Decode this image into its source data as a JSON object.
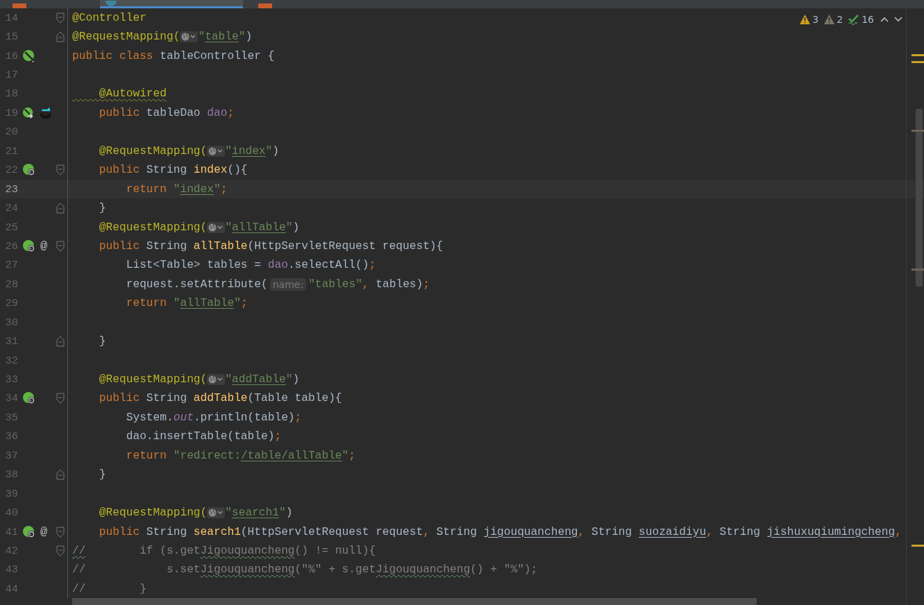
{
  "tabs": [
    {
      "kind": "jsp",
      "selected": false
    },
    {
      "kind": "java",
      "selected": true
    },
    {
      "kind": "jsp",
      "selected": false
    }
  ],
  "inspections": [
    {
      "kind": "warning",
      "count": "3"
    },
    {
      "kind": "weak-warning",
      "count": "2"
    },
    {
      "kind": "typo",
      "count": "16"
    }
  ],
  "lines": [
    {
      "number": "14",
      "fold_start": true,
      "fold_end": false,
      "tokens": [
        {
          "kind": "ann",
          "text": "@Controller"
        }
      ]
    },
    {
      "number": "15",
      "fold_start": false,
      "fold_end": true,
      "tokens": [
        {
          "kind": "ann",
          "text": "@RequestMapping("
        },
        {
          "kind": "url-icon"
        },
        {
          "kind": "str",
          "text": "\""
        },
        {
          "kind": "link",
          "text": "table"
        },
        {
          "kind": "str",
          "text": "\""
        },
        {
          "kind": "plain",
          "text": ")"
        }
      ]
    },
    {
      "number": "16",
      "fold_start": false,
      "fold_end": false,
      "markers": [
        {
          "kind": "bean"
        }
      ],
      "tokens": [
        {
          "kind": "kw",
          "text": "public class "
        },
        {
          "kind": "plain",
          "text": "tableController {"
        }
      ]
    },
    {
      "number": "17",
      "fold_start": false,
      "fold_end": false
    },
    {
      "number": "18",
      "fold_start": false,
      "fold_end": false,
      "tokens": [
        {
          "kind": "ann-warn",
          "text": "    @Autowired"
        }
      ]
    },
    {
      "number": "19",
      "fold_start": false,
      "fold_end": false,
      "markers": [
        {
          "kind": "bean-inject"
        },
        {
          "kind": "creature"
        }
      ],
      "tokens": [
        {
          "kind": "kw",
          "text": "    public "
        },
        {
          "kind": "plain",
          "text": "tableDao "
        },
        {
          "kind": "field",
          "text": "dao"
        },
        {
          "kind": "kw",
          "text": ";"
        }
      ]
    },
    {
      "number": "20",
      "fold_start": false,
      "fold_end": false
    },
    {
      "number": "21",
      "fold_start": false,
      "fold_end": false,
      "tokens": [
        {
          "kind": "ann",
          "text": "    @RequestMapping("
        },
        {
          "kind": "url-icon"
        },
        {
          "kind": "str",
          "text": "\""
        },
        {
          "kind": "link",
          "text": "index"
        },
        {
          "kind": "str",
          "text": "\""
        },
        {
          "kind": "plain",
          "text": ")"
        }
      ]
    },
    {
      "number": "22",
      "fold_start": true,
      "fold_end": false,
      "markers": [
        {
          "kind": "web"
        }
      ],
      "tokens": [
        {
          "kind": "kw",
          "text": "    public "
        },
        {
          "kind": "plain",
          "text": "String "
        },
        {
          "kind": "method",
          "text": "index"
        },
        {
          "kind": "plain",
          "text": "(){"
        }
      ]
    },
    {
      "number": "23",
      "fold_start": false,
      "fold_end": false,
      "current": true,
      "tokens": [
        {
          "kind": "kw",
          "text": "        return "
        },
        {
          "kind": "str",
          "text": "\""
        },
        {
          "kind": "link",
          "text": "index"
        },
        {
          "kind": "str",
          "text": "\""
        },
        {
          "kind": "kw",
          "text": ";"
        }
      ]
    },
    {
      "number": "24",
      "fold_start": false,
      "fold_end": true,
      "tokens": [
        {
          "kind": "plain",
          "text": "    }"
        }
      ]
    },
    {
      "number": "25",
      "fold_start": false,
      "fold_end": false,
      "tokens": [
        {
          "kind": "ann",
          "text": "    @RequestMapping("
        },
        {
          "kind": "url-icon"
        },
        {
          "kind": "str",
          "text": "\""
        },
        {
          "kind": "link",
          "text": "allTable"
        },
        {
          "kind": "str",
          "text": "\""
        },
        {
          "kind": "plain",
          "text": ")"
        }
      ]
    },
    {
      "number": "26",
      "fold_start": true,
      "fold_end": false,
      "markers": [
        {
          "kind": "web"
        },
        {
          "kind": "symbol",
          "text": "@"
        }
      ],
      "tokens": [
        {
          "kind": "kw",
          "text": "    public "
        },
        {
          "kind": "plain",
          "text": "String "
        },
        {
          "kind": "method",
          "text": "allTable"
        },
        {
          "kind": "plain",
          "text": "(HttpServletRequest request){"
        }
      ]
    },
    {
      "number": "27",
      "fold_start": false,
      "fold_end": false,
      "tokens": [
        {
          "kind": "plain",
          "text": "        List<Table> tables = "
        },
        {
          "kind": "field",
          "text": "dao"
        },
        {
          "kind": "plain",
          "text": ".selectAll()"
        },
        {
          "kind": "kw",
          "text": ";"
        }
      ]
    },
    {
      "number": "28",
      "fold_start": false,
      "fold_end": false,
      "tokens": [
        {
          "kind": "plain",
          "text": "        request.setAttribute("
        },
        {
          "kind": "hint",
          "text": "name:"
        },
        {
          "kind": "str",
          "text": "\"tables\""
        },
        {
          "kind": "kw",
          "text": ", "
        },
        {
          "kind": "plain",
          "text": "tables)"
        },
        {
          "kind": "kw",
          "text": ";"
        }
      ]
    },
    {
      "number": "29",
      "fold_start": false,
      "fold_end": false,
      "tokens": [
        {
          "kind": "kw",
          "text": "        return "
        },
        {
          "kind": "str",
          "text": "\""
        },
        {
          "kind": "link",
          "text": "allTable"
        },
        {
          "kind": "str",
          "text": "\""
        },
        {
          "kind": "kw",
          "text": ";"
        }
      ]
    },
    {
      "number": "30",
      "fold_start": false,
      "fold_end": false
    },
    {
      "number": "31",
      "fold_start": false,
      "fold_end": true,
      "tokens": [
        {
          "kind": "plain",
          "text": "    }"
        }
      ]
    },
    {
      "number": "32",
      "fold_start": false,
      "fold_end": false
    },
    {
      "number": "33",
      "fold_start": false,
      "fold_end": false,
      "tokens": [
        {
          "kind": "ann",
          "text": "    @RequestMapping("
        },
        {
          "kind": "url-icon"
        },
        {
          "kind": "str",
          "text": "\""
        },
        {
          "kind": "link",
          "text": "addTable"
        },
        {
          "kind": "str",
          "text": "\""
        },
        {
          "kind": "plain",
          "text": ")"
        }
      ]
    },
    {
      "number": "34",
      "fold_start": true,
      "fold_end": false,
      "markers": [
        {
          "kind": "web"
        }
      ],
      "tokens": [
        {
          "kind": "kw",
          "text": "    public "
        },
        {
          "kind": "plain",
          "text": "String "
        },
        {
          "kind": "method",
          "text": "addTable"
        },
        {
          "kind": "plain",
          "text": "(Table table){"
        }
      ]
    },
    {
      "number": "35",
      "fold_start": false,
      "fold_end": false,
      "tokens": [
        {
          "kind": "plain",
          "text": "        System."
        },
        {
          "kind": "static",
          "text": "out"
        },
        {
          "kind": "plain",
          "text": ".println(table)"
        },
        {
          "kind": "kw",
          "text": ";"
        }
      ]
    },
    {
      "number": "36",
      "fold_start": false,
      "fold_end": false,
      "tokens": [
        {
          "kind": "plain",
          "text": "        dao.insertTable(table)"
        },
        {
          "kind": "kw",
          "text": ";"
        }
      ]
    },
    {
      "number": "37",
      "fold_start": false,
      "fold_end": false,
      "tokens": [
        {
          "kind": "kw",
          "text": "        return "
        },
        {
          "kind": "str",
          "text": "\"redirect:"
        },
        {
          "kind": "link",
          "text": "/table/allTable"
        },
        {
          "kind": "str",
          "text": "\""
        },
        {
          "kind": "kw",
          "text": ";"
        }
      ]
    },
    {
      "number": "38",
      "fold_start": false,
      "fold_end": true,
      "tokens": [
        {
          "kind": "plain",
          "text": "    }"
        }
      ]
    },
    {
      "number": "39",
      "fold_start": false,
      "fold_end": false
    },
    {
      "number": "40",
      "fold_start": false,
      "fold_end": false,
      "tokens": [
        {
          "kind": "ann",
          "text": "    @RequestMapping("
        },
        {
          "kind": "url-icon"
        },
        {
          "kind": "str",
          "text": "\""
        },
        {
          "kind": "link",
          "text": "search1"
        },
        {
          "kind": "str",
          "text": "\""
        },
        {
          "kind": "plain",
          "text": ")"
        }
      ]
    },
    {
      "number": "41",
      "fold_start": true,
      "fold_end": false,
      "markers": [
        {
          "kind": "web"
        },
        {
          "kind": "symbol",
          "text": "@"
        }
      ],
      "tokens": [
        {
          "kind": "kw",
          "text": "    public "
        },
        {
          "kind": "plain",
          "text": "String "
        },
        {
          "kind": "method",
          "text": "search1"
        },
        {
          "kind": "plain",
          "text": "(HttpServletRequest request"
        },
        {
          "kind": "kw",
          "text": ", "
        },
        {
          "kind": "plain",
          "text": "String "
        },
        {
          "kind": "param",
          "text": "jigouquancheng"
        },
        {
          "kind": "kw",
          "text": ", "
        },
        {
          "kind": "plain",
          "text": "String "
        },
        {
          "kind": "param",
          "text": "suozaidiyu"
        },
        {
          "kind": "kw",
          "text": ", "
        },
        {
          "kind": "plain",
          "text": "String "
        },
        {
          "kind": "param",
          "text": "jishuxuqiumingcheng"
        },
        {
          "kind": "kw",
          "text": ","
        }
      ]
    },
    {
      "number": "42",
      "fold_start": true,
      "fold_end": false,
      "tokens": [
        {
          "kind": "comment-typo",
          "text": "//"
        },
        {
          "kind": "comment",
          "text": "        if (s.get"
        },
        {
          "kind": "comment-typo",
          "text": "Jigouquancheng"
        },
        {
          "kind": "comment",
          "text": "() != null){"
        }
      ]
    },
    {
      "number": "43",
      "fold_start": false,
      "fold_end": false,
      "tokens": [
        {
          "kind": "comment",
          "text": "//            s.set"
        },
        {
          "kind": "comment-typo",
          "text": "Jigouquancheng"
        },
        {
          "kind": "comment",
          "text": "(\"%\" + s.get"
        },
        {
          "kind": "comment-typo",
          "text": "Jigouquancheng"
        },
        {
          "kind": "comment",
          "text": "() + \"%\");"
        }
      ]
    },
    {
      "number": "44",
      "fold_start": false,
      "fold_end": false,
      "tokens": [
        {
          "kind": "comment",
          "text": "//        }"
        }
      ]
    }
  ]
}
